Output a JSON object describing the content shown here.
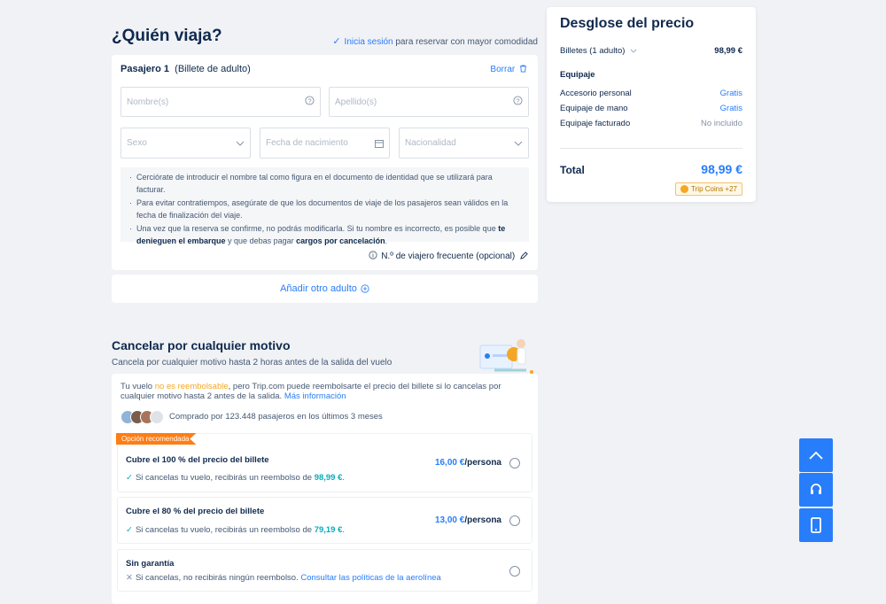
{
  "header": {
    "title": "¿Quién viaja?",
    "login_link": "Inicia sesión",
    "login_suffix": "para reservar con mayor comodidad"
  },
  "passenger": {
    "label": "Pasajero 1",
    "type": "(Billete de adulto)",
    "delete_label": "Borrar",
    "first_name_placeholder": "Nombre(s)",
    "last_name_placeholder": "Apellido(s)",
    "sex_placeholder": "Sexo",
    "birthdate_placeholder": "Fecha de nacimiento",
    "nationality_placeholder": "Nacionalidad",
    "note1": "Cerciórate de introducir el nombre tal como figura en el documento de identidad que se utilizará para facturar.",
    "note2": "Para evitar contratiempos, asegúrate de que los documentos de viaje de los pasajeros sean válidos en la fecha de finalización del viaje.",
    "note3_a": "Una vez que la reserva se confirme, no podrás modificarla. Si tu nombre es incorrecto, es posible que",
    "note3_b": "te denieguen el embarque",
    "note3_c": "y que debas pagar",
    "note3_d": "cargos por cancelación",
    "note3_e": ".",
    "frequent_flyer": "N.º de viajero frecuente (opcional)"
  },
  "add_adult": "Añadir otro adulto",
  "cancel": {
    "title": "Cancelar por cualquier motivo",
    "subtitle": "Cancela por cualquier motivo hasta 2 horas antes de la salida del vuelo",
    "text_a": "Tu vuelo",
    "text_b": "no es reembolsable",
    "text_c": ", pero Trip.com puede reembolsarte el precio del billete si lo cancelas por cualquier motivo hasta 2 antes de la salida.",
    "more_info": "Más información",
    "bought": "Comprado por 123.448 pasajeros en los últimos 3 meses",
    "recommended_badge": "Opción recomendada",
    "options": [
      {
        "title": "Cubre el 100 % del precio del billete",
        "desc": "Si cancelas tu vuelo, recibirás un reembolso de",
        "amount": "98,99 €",
        "price": "16,00 €",
        "per": "/persona"
      },
      {
        "title": "Cubre el 80 % del precio del billete",
        "desc": "Si cancelas tu vuelo, recibirás un reembolso de",
        "amount": "79,19 €",
        "price": "13,00 €",
        "per": "/persona"
      },
      {
        "title": "Sin garantía",
        "desc": "Si cancelas, no recibirás ningún reembolso.",
        "link": "Consultar las políticas de la aerolínea"
      }
    ]
  },
  "price_breakdown": {
    "title": "Desglose del precio",
    "tickets_label": "Billetes (1 adulto)",
    "tickets_value": "98,99 €",
    "baggage_heading": "Equipaje",
    "rows": [
      {
        "label": "Accesorio personal",
        "value": "Gratis"
      },
      {
        "label": "Equipaje de mano",
        "value": "Gratis"
      },
      {
        "label": "Equipaje facturado",
        "value": "No incluido"
      }
    ],
    "total_label": "Total",
    "total_value": "98,99 €",
    "coins": "Trip Coins +27"
  },
  "colors": {
    "accent": "#287dfa",
    "warning": "#f5a623",
    "success": "#06aebd"
  }
}
